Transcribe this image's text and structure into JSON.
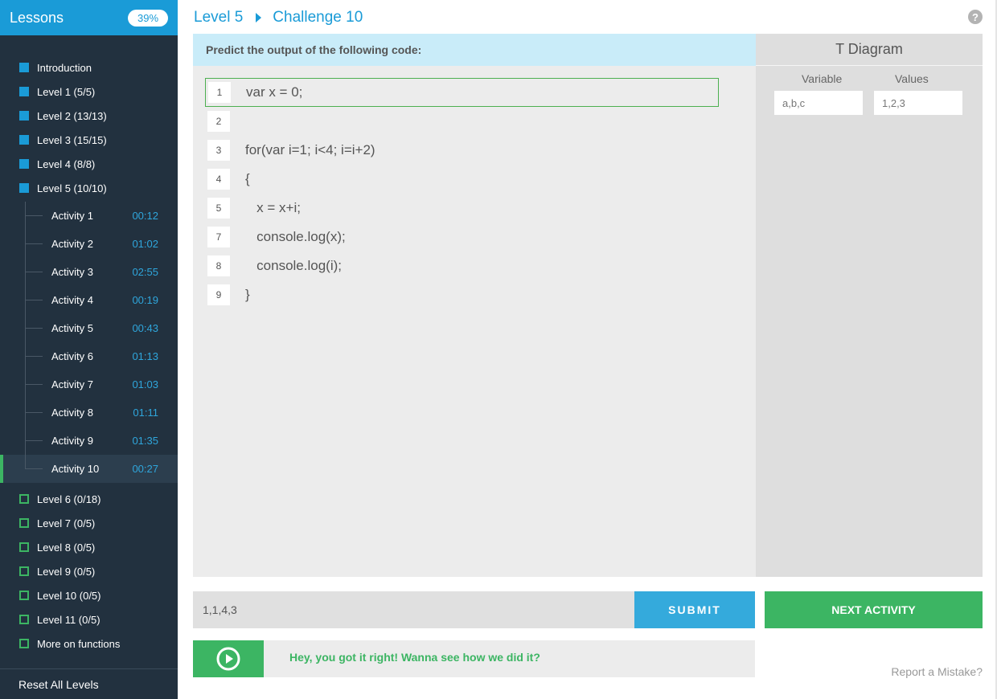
{
  "sidebar": {
    "title": "Lessons",
    "progress": "39%",
    "levels_top": [
      {
        "label": "Introduction"
      },
      {
        "label": "Level 1 (5/5)"
      },
      {
        "label": "Level 2 (13/13)"
      },
      {
        "label": "Level 3 (15/15)"
      },
      {
        "label": "Level 4 (8/8)"
      },
      {
        "label": "Level 5 (10/10)"
      }
    ],
    "activities": [
      {
        "label": "Activity 1",
        "time": "00:12"
      },
      {
        "label": "Activity 2",
        "time": "01:02"
      },
      {
        "label": "Activity 3",
        "time": "02:55"
      },
      {
        "label": "Activity 4",
        "time": "00:19"
      },
      {
        "label": "Activity 5",
        "time": "00:43"
      },
      {
        "label": "Activity 6",
        "time": "01:13"
      },
      {
        "label": "Activity 7",
        "time": "01:03"
      },
      {
        "label": "Activity 8",
        "time": "01:11"
      },
      {
        "label": "Activity 9",
        "time": "01:35"
      },
      {
        "label": "Activity 10",
        "time": "00:27"
      }
    ],
    "levels_bottom": [
      {
        "label": "Level 6 (0/18)"
      },
      {
        "label": "Level 7 (0/5)"
      },
      {
        "label": "Level 8 (0/5)"
      },
      {
        "label": "Level 9 (0/5)"
      },
      {
        "label": "Level 10 (0/5)"
      },
      {
        "label": "Level 11 (0/5)"
      },
      {
        "label": "More on functions"
      }
    ],
    "reset_label": "Reset All Levels"
  },
  "header": {
    "level": "Level 5",
    "challenge": "Challenge 10",
    "help_icon": "?"
  },
  "code_panel": {
    "prompt": "Predict the output of the following code:",
    "lines": [
      {
        "num": "1",
        "text": "var x = 0;"
      },
      {
        "num": "2",
        "text": ""
      },
      {
        "num": "3",
        "text": "for(var i=1; i<4; i=i+2)"
      },
      {
        "num": "4",
        "text": "{"
      },
      {
        "num": "5",
        "text": "   x = x+i;"
      },
      {
        "num": "7",
        "text": "   console.log(x);"
      },
      {
        "num": "8",
        "text": "   console.log(i);"
      },
      {
        "num": "9",
        "text": "}"
      }
    ]
  },
  "t_diagram": {
    "title": "T Diagram",
    "variable_header": "Variable",
    "values_header": "Values",
    "variable_value": "a,b,c",
    "values_value": "1,2,3"
  },
  "answer": {
    "value": "1,1,4,3",
    "submit_label": "SUBMIT",
    "next_label": "NEXT ACTIVITY"
  },
  "feedback": {
    "message": "Hey, you got it right! Wanna see how we did it?",
    "report_label": "Report a Mistake?"
  },
  "colors": {
    "accent_blue": "#1a9bd7",
    "accent_green": "#3cb563",
    "sidebar_bg": "#22313f"
  }
}
